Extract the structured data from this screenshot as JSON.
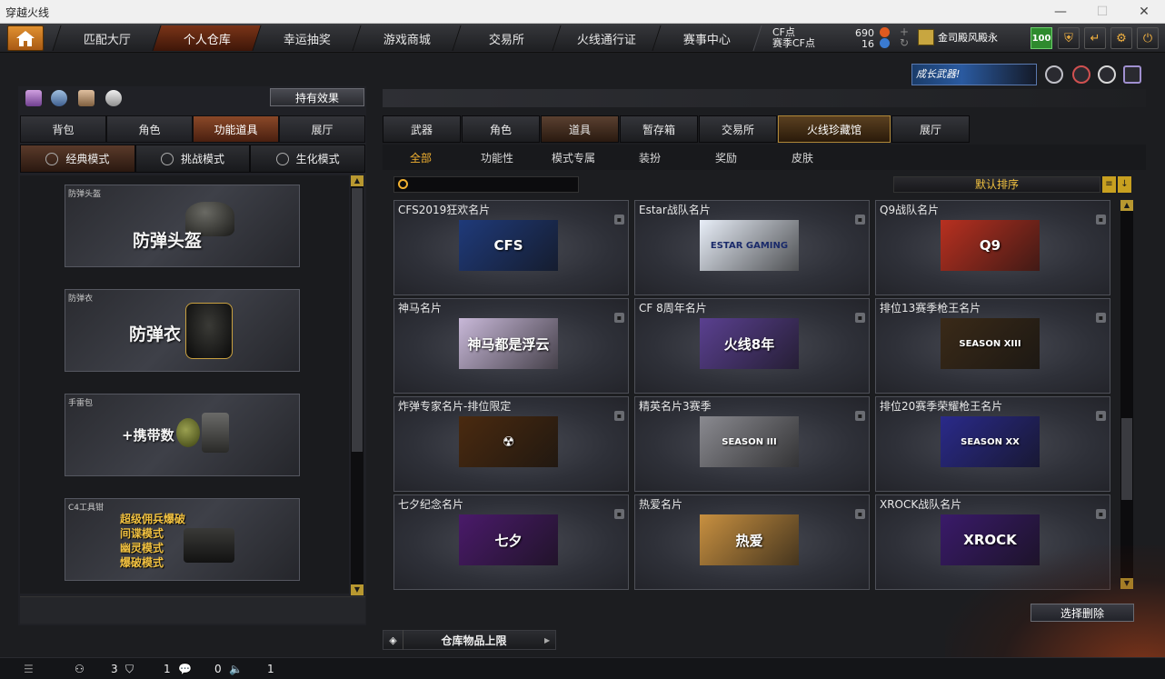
{
  "window": {
    "title": "穿越火线",
    "min": "—",
    "max": "☐",
    "close": "✕"
  },
  "topnav": {
    "tabs": [
      "匹配大厅",
      "个人仓库",
      "幸运抽奖",
      "游戏商城",
      "交易所",
      "火线通行证",
      "赛事中心"
    ],
    "active": 1
  },
  "currency": {
    "cf_label": "CF点",
    "cf_value": "690",
    "season_label": "赛季CF点",
    "season_value": "16"
  },
  "rank": {
    "name": "金司殿风殿永"
  },
  "level": "100",
  "growth_banner": "成长武器!",
  "left": {
    "hold_effect": "持有效果",
    "tabs": [
      "背包",
      "角色",
      "功能道具",
      "展厅"
    ],
    "active_tab": 2,
    "modes": [
      "经典模式",
      "挑战模式",
      "生化模式"
    ],
    "active_mode": 0,
    "items": [
      {
        "label": "防弹头盔",
        "big": "防弹头盔"
      },
      {
        "label": "防弹衣",
        "big": "防弹衣"
      },
      {
        "label": "手雷包",
        "big": "+携带数"
      },
      {
        "label": "C4工具钳",
        "lines": [
          "超级佣兵爆破",
          "间谍模式",
          "幽灵模式",
          "爆破模式"
        ]
      }
    ]
  },
  "right": {
    "tabs": [
      "武器",
      "角色",
      "道具",
      "暂存箱",
      "交易所",
      "火线珍藏馆",
      "展厅"
    ],
    "active_tab": 5,
    "subtabs": [
      "全部",
      "功能性",
      "模式专属",
      "装扮",
      "奖励",
      "皮肤"
    ],
    "active_subtab": 0,
    "sort_label": "默认排序",
    "cards": [
      {
        "title": "CFS2019狂欢名片",
        "art": "CFS",
        "bg": "#1f3a7a"
      },
      {
        "title": "Estar战队名片",
        "art": "ESTAR GAMING",
        "bg": "#e8eef8"
      },
      {
        "title": "Q9战队名片",
        "art": "Q9",
        "bg": "#b83020"
      },
      {
        "title": "神马名片",
        "art": "神马都是浮云",
        "bg": "#c8b8d8"
      },
      {
        "title": "CF 8周年名片",
        "art": "火线8年",
        "bg": "#5a4090"
      },
      {
        "title": "排位13赛季枪王名片",
        "art": "SEASON XIII",
        "bg": "#3a2a18"
      },
      {
        "title": "炸弹专家名片-排位限定",
        "art": "☢",
        "bg": "#4a2a10"
      },
      {
        "title": "精英名片3赛季",
        "art": "SEASON III",
        "bg": "#8a8a90"
      },
      {
        "title": "排位20赛季荣耀枪王名片",
        "art": "SEASON XX",
        "bg": "#2a2a8a"
      },
      {
        "title": "七夕纪念名片",
        "art": "七夕",
        "bg": "#4a1a6a"
      },
      {
        "title": "热爱名片",
        "art": "热爱",
        "bg": "#c89040"
      },
      {
        "title": "XROCK战队名片",
        "art": "XROCK",
        "bg": "#3a1a6a"
      }
    ],
    "delete_selected": "选择删除",
    "capacity": "仓库物品上限"
  },
  "status": {
    "friends": "3",
    "shield": "1",
    "chat": "0",
    "voice": "1"
  }
}
